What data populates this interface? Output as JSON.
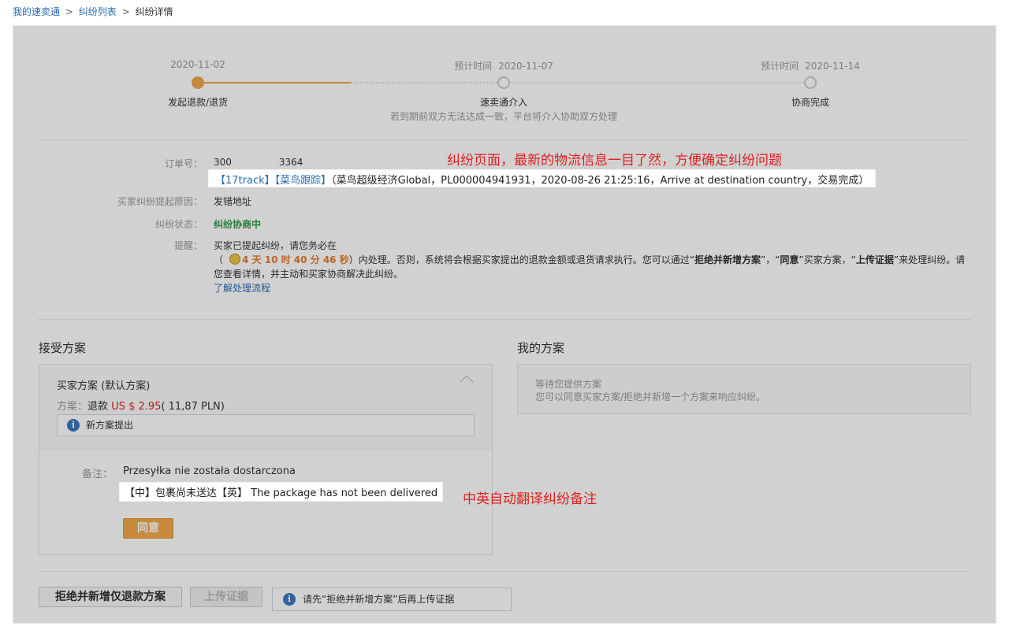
{
  "breadcrumb": {
    "home": "我的速卖通",
    "list": "纠纷列表",
    "current": "纠纷详情",
    "sep": ">"
  },
  "steps": [
    {
      "date_label": "",
      "date": "2020-11-02",
      "name": "发起退款/退货",
      "note": ""
    },
    {
      "date_label": "预计时间",
      "date": "2020-11-07",
      "name": "速卖通介入",
      "note": "若到期前双方无法达成一致，平台将介入协助双方处理"
    },
    {
      "date_label": "预计时间",
      "date": "2020-11-14",
      "name": "协商完成",
      "note": ""
    }
  ],
  "order": {
    "label": "订单号：",
    "number_prefix": "300",
    "number_suffix": "3364"
  },
  "tracking": {
    "link_17track": "【17track】",
    "link_cainiao": "【菜鸟跟踪】",
    "detail": "（菜鸟超级经济Global，PL000004941931，2020-08-26 21:25:16，Arrive at destination country，交易完成）"
  },
  "annotations": {
    "top": "纠纷页面，最新的物流信息一目了然，方便确定纠纷问题",
    "bottom": "中英自动翻译纠纷备注"
  },
  "reason": {
    "label": "买家纠纷提起原因：",
    "value": "发错地址"
  },
  "status": {
    "label": "纠纷状态：",
    "value": "纠纷协商中"
  },
  "remind": {
    "label": "提醒：",
    "line1": "买家已提起纠纷，请您务必在",
    "countdown": "4 天 10 时 40 分 46 秒",
    "line2_a": "）内处理。否则，系统将会根据买家提出的退款金额或退货请求执行。您可以通过“",
    "bold1": "拒绝并新增方案",
    "line2_b": "”，“",
    "bold2": "同意",
    "line2_c": "”买家方案，“",
    "bold3": "上传证据",
    "line2_d": "”来处理纠纷。请您查看详情，并主动和买家协商解决此纠纷。",
    "open_paren": "（",
    "learn_link": "了解处理流程"
  },
  "accept_section": {
    "title": "接受方案",
    "plan_title": "买家方案 (默认方案)",
    "plan_label": "方案：",
    "plan_type": "退款",
    "amount": "US $ 2.95",
    "amount_local": "( 11,87 PLN)",
    "notice": "新方案提出",
    "remark_label": "备注：",
    "remark_original": "Przesyłka nie została dostarczona",
    "remark_translation": "【中】包裹尚未送达【英】 The package has not been delivered",
    "agree_button": "同意"
  },
  "my_section": {
    "title": "我的方案",
    "waiting": "等待您提供方案",
    "hint": "您可以同意买家方案/拒绝并新增一个方案来响应纠纷。"
  },
  "footer": {
    "reject_button": "拒绝并新增仅退款方案",
    "upload_button": "上传证据",
    "notice": "请先“拒绝并新增方案”后再上传证据"
  },
  "colors": {
    "accent_orange": "#f0a64a",
    "link_blue": "#2a6bb5",
    "status_green": "#2e9a45",
    "annotation_red": "#e02020"
  }
}
